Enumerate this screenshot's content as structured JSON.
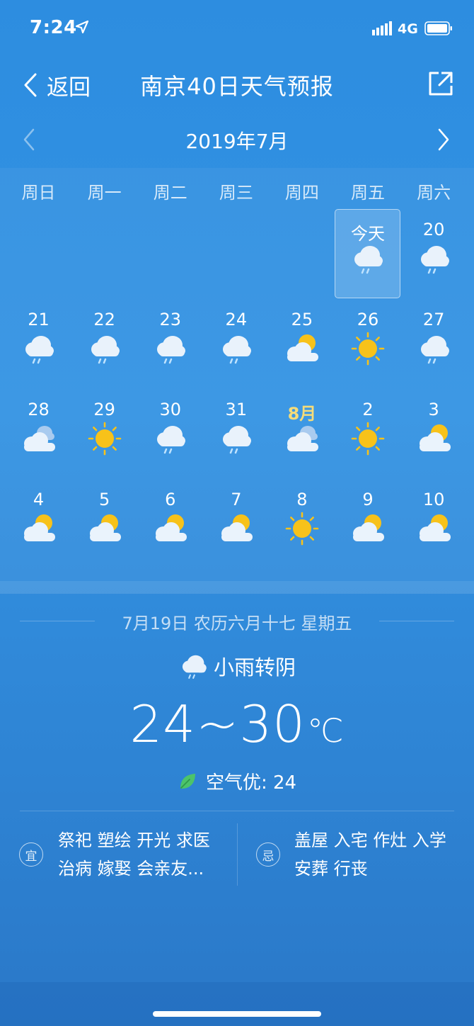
{
  "status_bar": {
    "time": "7:24",
    "network": "4G"
  },
  "header": {
    "back_label": "返回",
    "title": "南京40日天气预报"
  },
  "month_nav": {
    "label": "2019年7月"
  },
  "calendar": {
    "weekdays": [
      "周日",
      "周一",
      "周二",
      "周三",
      "周四",
      "周五",
      "周六"
    ],
    "rows": [
      [
        {
          "label": "",
          "icon": ""
        },
        {
          "label": "",
          "icon": ""
        },
        {
          "label": "",
          "icon": ""
        },
        {
          "label": "",
          "icon": ""
        },
        {
          "label": "",
          "icon": ""
        },
        {
          "label": "今天",
          "icon": "rain-cloud-icon",
          "today": true
        },
        {
          "label": "20",
          "icon": "rain-cloud-icon"
        }
      ],
      [
        {
          "label": "21",
          "icon": "rain-cloud-icon"
        },
        {
          "label": "22",
          "icon": "rain-cloud-icon"
        },
        {
          "label": "23",
          "icon": "rain-cloud-icon"
        },
        {
          "label": "24",
          "icon": "rain-cloud-icon"
        },
        {
          "label": "25",
          "icon": "partly-cloudy-icon"
        },
        {
          "label": "26",
          "icon": "sun-icon"
        },
        {
          "label": "27",
          "icon": "rain-cloud-icon"
        }
      ],
      [
        {
          "label": "28",
          "icon": "overcast-icon"
        },
        {
          "label": "29",
          "icon": "sun-icon"
        },
        {
          "label": "30",
          "icon": "rain-cloud-icon"
        },
        {
          "label": "31",
          "icon": "rain-cloud-icon"
        },
        {
          "label": "8月",
          "icon": "overcast-icon",
          "month": true
        },
        {
          "label": "2",
          "icon": "sun-icon"
        },
        {
          "label": "3",
          "icon": "partly-cloudy-icon"
        }
      ],
      [
        {
          "label": "4",
          "icon": "partly-cloudy-icon"
        },
        {
          "label": "5",
          "icon": "partly-cloudy-icon"
        },
        {
          "label": "6",
          "icon": "partly-cloudy-icon"
        },
        {
          "label": "7",
          "icon": "partly-cloudy-icon"
        },
        {
          "label": "8",
          "icon": "sun-icon"
        },
        {
          "label": "9",
          "icon": "partly-cloudy-icon"
        },
        {
          "label": "10",
          "icon": "partly-cloudy-icon"
        }
      ]
    ]
  },
  "detail": {
    "date_line": "7月19日 农历六月十七 星期五",
    "condition": "小雨转阴",
    "condition_icon": "rain-cloud-icon",
    "temp_range": "24~30",
    "temp_unit": "℃",
    "aqi": "空气优: 24",
    "yi_badge": "宜",
    "yi_items": [
      "祭祀 塑绘 开光 求医",
      "治病 嫁娶 会亲友..."
    ],
    "ji_badge": "忌",
    "ji_items": [
      "盖屋 入宅 作灶 入学",
      "安葬 行丧"
    ]
  },
  "colors": {
    "background": "#3393e3",
    "sun": "#f7c21a",
    "month_highlight": "#f5dc7a",
    "leaf": "#4cc46a"
  }
}
